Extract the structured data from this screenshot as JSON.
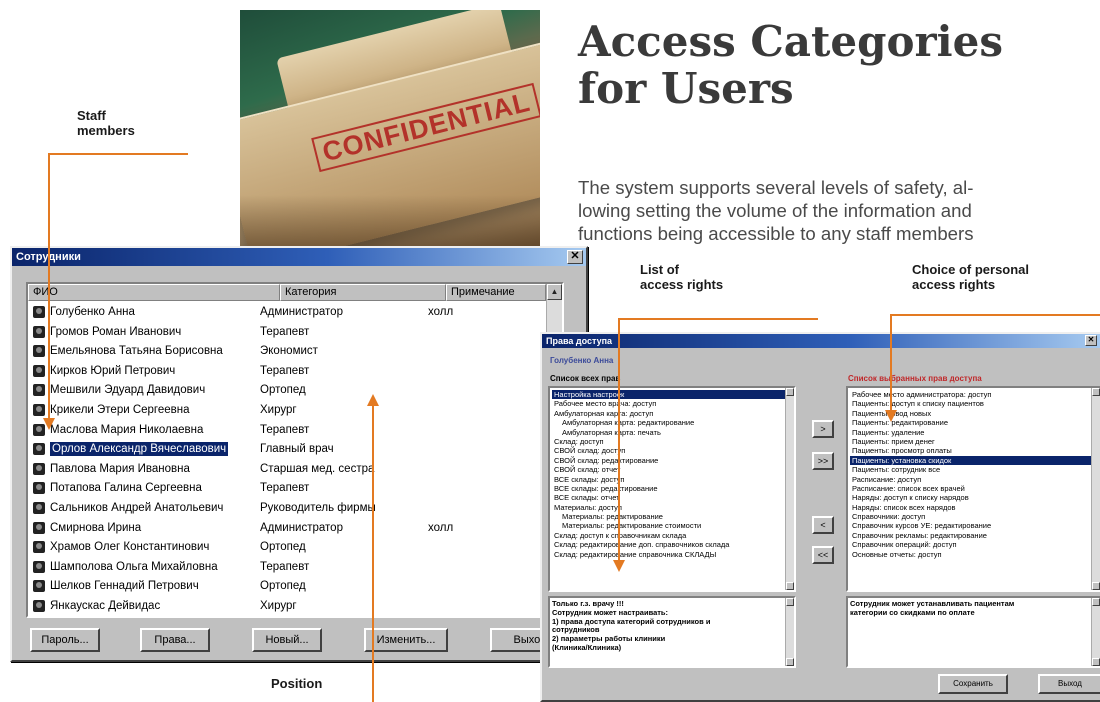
{
  "article": {
    "title_line1": "Access Categories",
    "title_line2": "for Users",
    "lead_lines": [
      "The system supports several levels of safety, al-",
      "lowing setting the volume of the information and",
      "functions being accessible to any staff members"
    ]
  },
  "photo": {
    "stamp_text": "CONFIDENTIAL"
  },
  "callouts": {
    "staff_members": [
      "Staff",
      "members"
    ],
    "position": "Position",
    "list_of_access_rights": [
      "List of",
      "access rights"
    ],
    "choice_personal": [
      "Choice of personal",
      "access rights"
    ]
  },
  "colors": {
    "callout": "#e37a22",
    "title_bar": "#0a246a",
    "selection": "#0a246a"
  },
  "staff_window": {
    "title": "Сотрудники",
    "columns": [
      "ФИО",
      "Категория",
      "Примечание"
    ],
    "rows": [
      {
        "name": "Голубенко Анна",
        "category": "Администратор",
        "note": "холл"
      },
      {
        "name": "Громов Роман Иванович",
        "category": "Терапевт",
        "note": ""
      },
      {
        "name": "Емельянова Татьяна Борисовна",
        "category": "Экономист",
        "note": ""
      },
      {
        "name": "Кирков Юрий Петрович",
        "category": "Терапевт",
        "note": ""
      },
      {
        "name": "Мешвили Эдуард Давидович",
        "category": "Ортопед",
        "note": ""
      },
      {
        "name": "Крикели Этери Сергеевна",
        "category": "Хирург",
        "note": ""
      },
      {
        "name": "Маслова Мария Николаевна",
        "category": "Терапевт",
        "note": ""
      },
      {
        "name": "Орлов Александр Вячеславович",
        "category": "Главный врач",
        "note": ""
      },
      {
        "name": "Павлова Мария Ивановна",
        "category": "Старшая мед. сестра",
        "note": ""
      },
      {
        "name": "Потапова Галина Сергеевна",
        "category": "Терапевт",
        "note": ""
      },
      {
        "name": "Сальников Андрей Анатольевич",
        "category": "Руководитель фирмы",
        "note": ""
      },
      {
        "name": "Смирнова Ирина",
        "category": "Администратор",
        "note": "холл"
      },
      {
        "name": "Храмов Олег Константинович",
        "category": "Ортопед",
        "note": ""
      },
      {
        "name": "Шамполова Ольга Михайловна",
        "category": "Терапевт",
        "note": ""
      },
      {
        "name": "Шелков Геннадий Петрович",
        "category": "Ортопед",
        "note": ""
      },
      {
        "name": "Янкаускас Дейвидас",
        "category": "Хирург",
        "note": ""
      }
    ],
    "selected_index": 7,
    "buttons": {
      "password": "Пароль...",
      "rights": "Права...",
      "new": "Новый...",
      "edit": "Изменить...",
      "exit": "Выход"
    }
  },
  "access_window": {
    "title": "Права доступа",
    "user": "Голубенко Анна",
    "all_rights_title": "Список всех прав",
    "selected_rights_title": "Список выбранных прав доступа",
    "all_rights": [
      "Настройка настроек",
      "Рабочее место врача: доступ",
      "Амбулаторная карта: доступ",
      "Амбулаторная карта: редактирование",
      "Амбулаторная карта: печать",
      "Склад: доступ",
      "СВОЙ склад: доступ",
      "СВОЙ склад: редактирование",
      "СВОЙ склад: отчет",
      "ВСЕ склады: доступ",
      "ВСЕ склады: редактирование",
      "ВСЕ склады: отчет",
      "Материалы: доступ",
      "Материалы: редактирование",
      "Материалы: редактирование стоимости",
      "Склад: доступ к справочникам склада",
      "Склад: редактирование доп. справочников склада",
      "Склад: редактирование справочника СКЛАДЫ"
    ],
    "selected_rights": [
      "Рабочее место администратора: доступ",
      "Пациенты: доступ к списку пациентов",
      "Пациенты: ввод новых",
      "Пациенты: редактирование",
      "Пациенты: удаление",
      "Пациенты: прием денег",
      "Пациенты: просмотр оплаты",
      "Пациенты: установка скидок",
      "Пациенты: сотрудник все",
      "Расписание: доступ",
      "Расписание: список всех врачей",
      "Наряды: доступ к списку нарядов",
      "Наряды: список всех нарядов",
      "Справочники: доступ",
      "Справочник курсов УЕ: редактирование",
      "Справочник рекламы: редактирование",
      "Справочник операций: доступ",
      "Основные отчеты: доступ"
    ],
    "all_selected_index": 0,
    "selected_selected_index": 7,
    "left_note": [
      "Только г.з. врачу !!!",
      "Сотрудник может настраивать:",
      "1) права доступа категорий сотрудников и",
      "сотрудников",
      "2) параметры работы клиники",
      "(Клиника/Клиника)"
    ],
    "right_note": [
      "Сотрудник может устанавливать пациентам",
      "категории со скидками по оплате"
    ],
    "arrow_buttons": [
      ">",
      ">>",
      "<",
      "<<"
    ],
    "buttons": {
      "save": "Сохранить",
      "exit": "Выход"
    }
  }
}
